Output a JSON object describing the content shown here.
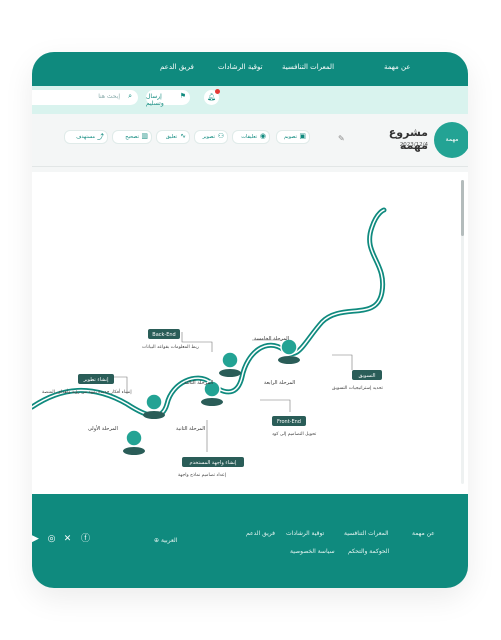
{
  "nav": {
    "links": [
      "عن مهمة",
      "المعرات التنافسية",
      "توقية الرشادات",
      "فريق الدعم"
    ]
  },
  "toolbar": {
    "search_placeholder": "إبحث هنا",
    "send_label": "إرسال وتسليم"
  },
  "project": {
    "logo_text": "مهمة",
    "title": "مشروع مهمة",
    "date": "2023/12/4"
  },
  "tools": [
    "تصويم",
    "تعليقات",
    "تصوير",
    "تعليق",
    "تصحيح",
    "مستهدف"
  ],
  "roadmap": {
    "dark_labels": [
      "Back-End",
      "إنشاء تطوير",
      "Front-End",
      "إنشاء واجهة المستخدم",
      "التسويق"
    ],
    "stage_titles": [
      "المرحلة الخامسة",
      "المرحلة الرابعة",
      "المرحلة الثالثة",
      "المرحلة الثانية",
      "المرحلة الأولى"
    ],
    "descriptions": [
      "ربط المعلومات بقواعد البيانات",
      "إنشاء أفكار جديدة يمهد من رؤية وأهداف المنصة",
      "تحويل التصاميم إلى كود",
      "إعداد تصاميم نماذج واجهة",
      "تحديد إستراتيجيات التسويق"
    ]
  },
  "footer": {
    "language": "العربية",
    "links_row1": [
      "عن مهمة",
      "المعرات التنافسية",
      "توقية الرشادات",
      "فريق الدعم"
    ],
    "links_row2": [
      "الحوكمة والتحكم",
      "سياسة الخصوصية"
    ]
  },
  "colors": {
    "primary": "#0f8a7e",
    "light": "#d9f3ee",
    "dark": "#2a5d58"
  }
}
